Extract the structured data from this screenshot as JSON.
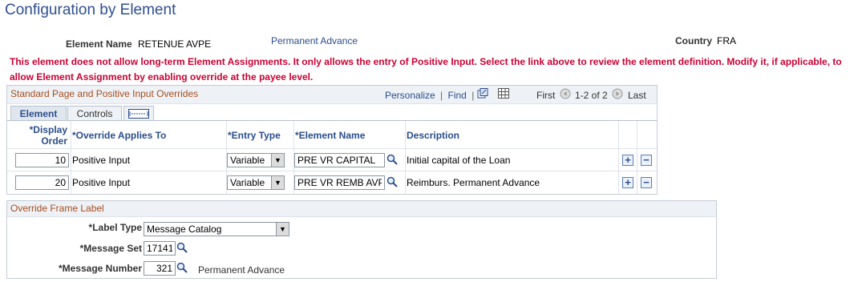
{
  "page": {
    "title": "Configuration by Element",
    "element_name_label": "Element Name",
    "element_name_value": "RETENUE AVPE",
    "element_link": "Permanent Advance",
    "country_label": "Country",
    "country_value": "FRA",
    "warning": "This element does not allow long-term Element Assignments. It only allows the entry of Positive Input.  Select the link above to review the element definition.  Modify it, if applicable, to allow Element Assignment by enabling override at the payee level."
  },
  "grid": {
    "title": "Standard Page and Positive Input Overrides",
    "personalize": "Personalize",
    "find": "Find",
    "sep": "|",
    "first": "First",
    "range": "1-2 of 2",
    "last": "Last",
    "tabs": [
      "Element",
      "Controls"
    ],
    "columns": {
      "display_order": "*Display Order",
      "override": "*Override Applies To",
      "entry_type": "*Entry Type",
      "element_name": "*Element Name",
      "description": "Description"
    },
    "rows": [
      {
        "order": "10",
        "override": "Positive Input",
        "entry_type": "Variable",
        "element_name": "PRE VR CAPITAL",
        "description": "Initial capital of the Loan"
      },
      {
        "order": "20",
        "override": "Positive Input",
        "entry_type": "Variable",
        "element_name": "PRE VR REMB AVPE",
        "description": "Reimburs. Permanent Advance"
      }
    ]
  },
  "frame": {
    "title": "Override Frame Label",
    "label_type_label": "*Label Type",
    "label_type_value": "Message Catalog",
    "message_set_label": "*Message Set",
    "message_set_value": "17141",
    "message_number_label": "*Message Number",
    "message_number_value": "321",
    "message_text": "Permanent Advance"
  }
}
